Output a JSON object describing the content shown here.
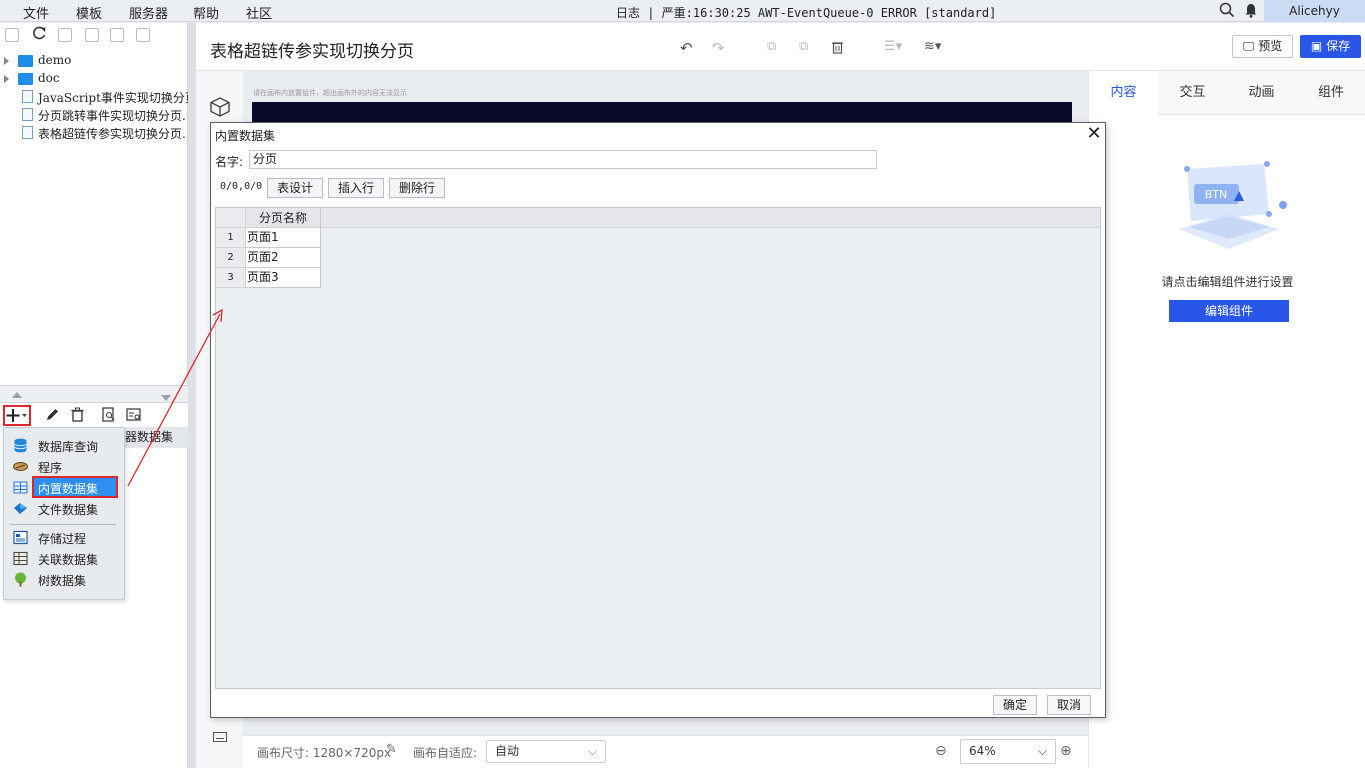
{
  "menubar": {
    "items": [
      "文件",
      "模板",
      "服务器",
      "帮助",
      "社区"
    ],
    "log_status": "日志 | 严重:16:30:25 AWT-EventQueue-0 ERROR [standard]",
    "user": "Alicehyy"
  },
  "tree": {
    "items": [
      {
        "label": "demo",
        "type": "folder"
      },
      {
        "label": "doc",
        "type": "folder"
      },
      {
        "label": "JavaScript事件实现切换分页",
        "type": "file"
      },
      {
        "label": "分页跳转事件实现切换分页.",
        "type": "file"
      },
      {
        "label": "表格超链传参实现切换分页.",
        "type": "file"
      }
    ]
  },
  "datasets": {
    "header_label": "器数据集",
    "add_menu": [
      {
        "label": "数据库查询",
        "icon": "database-icon"
      },
      {
        "label": "程序",
        "icon": "program-icon"
      },
      {
        "label": "内置数据集",
        "icon": "builtin-dataset-icon",
        "highlighted": true
      },
      {
        "label": "文件数据集",
        "icon": "file-dataset-icon"
      },
      {
        "label": "存储过程",
        "icon": "stored-procedure-icon"
      },
      {
        "label": "关联数据集",
        "icon": "joined-dataset-icon"
      },
      {
        "label": "树数据集",
        "icon": "tree-dataset-icon"
      }
    ]
  },
  "header": {
    "title": "表格超链传参实现切换分页",
    "preview_label": "预览",
    "save_label": "保存"
  },
  "canvas": {
    "hint": "请在画布内放置组件，超出画布外的内容无法显示",
    "size_label": "画布尺寸: 1280×720px",
    "fit_label": "画布自适应:",
    "fit_value": "自动",
    "zoom_value": "64%"
  },
  "right_panel": {
    "tabs": [
      "内容",
      "交互",
      "动画",
      "组件"
    ],
    "active_tab": 0,
    "hint": "请点击编辑组件进行设置",
    "edit_button": "编辑组件",
    "illustration_text": "BTN"
  },
  "dialog": {
    "title": "内置数据集",
    "name_label": "名字:",
    "name_value": "分页",
    "position": "0/0,0/0",
    "buttons": [
      "表设计",
      "插入行",
      "删除行"
    ],
    "column_header": "分页名称",
    "rows": [
      {
        "num": "1",
        "value": "页面1"
      },
      {
        "num": "2",
        "value": "页面2"
      },
      {
        "num": "3",
        "value": "页面3"
      }
    ],
    "ok_label": "确定",
    "cancel_label": "取消"
  },
  "colors": {
    "accent": "#2956e8",
    "highlight_border": "#e0262d",
    "folder": "#1f8ee8"
  }
}
